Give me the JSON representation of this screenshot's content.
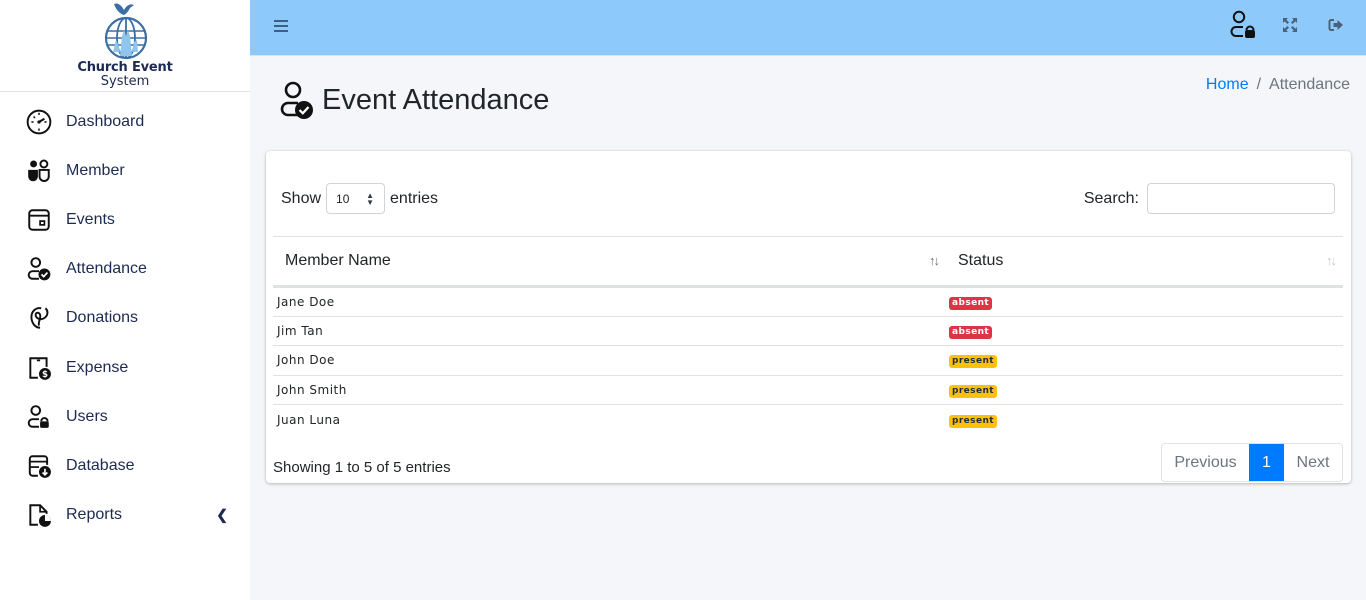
{
  "sidebar": {
    "brand": {
      "title": "Church Event",
      "subtitle": "System"
    },
    "items": [
      {
        "label": "Dashboard",
        "icon": "speedometer-icon"
      },
      {
        "label": "Member",
        "icon": "people-icon"
      },
      {
        "label": "Events",
        "icon": "calendar-event-icon"
      },
      {
        "label": "Attendance",
        "icon": "person-check-icon"
      },
      {
        "label": "Donations",
        "icon": "hand-heart-icon"
      },
      {
        "label": "Expense",
        "icon": "receipt-dollar-icon"
      },
      {
        "label": "Users",
        "icon": "person-lock-icon"
      },
      {
        "label": "Database",
        "icon": "database-down-icon"
      },
      {
        "label": "Reports",
        "icon": "file-chart-icon",
        "has_submenu": true
      }
    ]
  },
  "topbar": {
    "icons": [
      "menu-icon",
      "user-lock-icon",
      "fullscreen-icon",
      "logout-icon"
    ]
  },
  "page": {
    "title": "Event Attendance",
    "breadcrumb": {
      "home": "Home",
      "separator": "/",
      "current": "Attendance"
    }
  },
  "table_controls": {
    "show_label": "Show",
    "entries_label": "entries",
    "page_length": "10",
    "search_label": "Search:",
    "search_value": ""
  },
  "table": {
    "columns": [
      "Member Name",
      "Status"
    ],
    "rows": [
      {
        "name": "Jane Doe",
        "status": "absent"
      },
      {
        "name": "Jim Tan",
        "status": "absent"
      },
      {
        "name": "John Doe",
        "status": "present"
      },
      {
        "name": "John Smith",
        "status": "present"
      },
      {
        "name": "Juan Luna",
        "status": "present"
      }
    ]
  },
  "footer": {
    "info": "Showing 1 to 5 of 5 entries",
    "pagination": {
      "previous": "Previous",
      "current_page": "1",
      "next": "Next"
    }
  },
  "colors": {
    "header_bg": "#8ec9fc",
    "primary": "#007bff",
    "absent": "#dc3545",
    "present": "#ffc107"
  }
}
